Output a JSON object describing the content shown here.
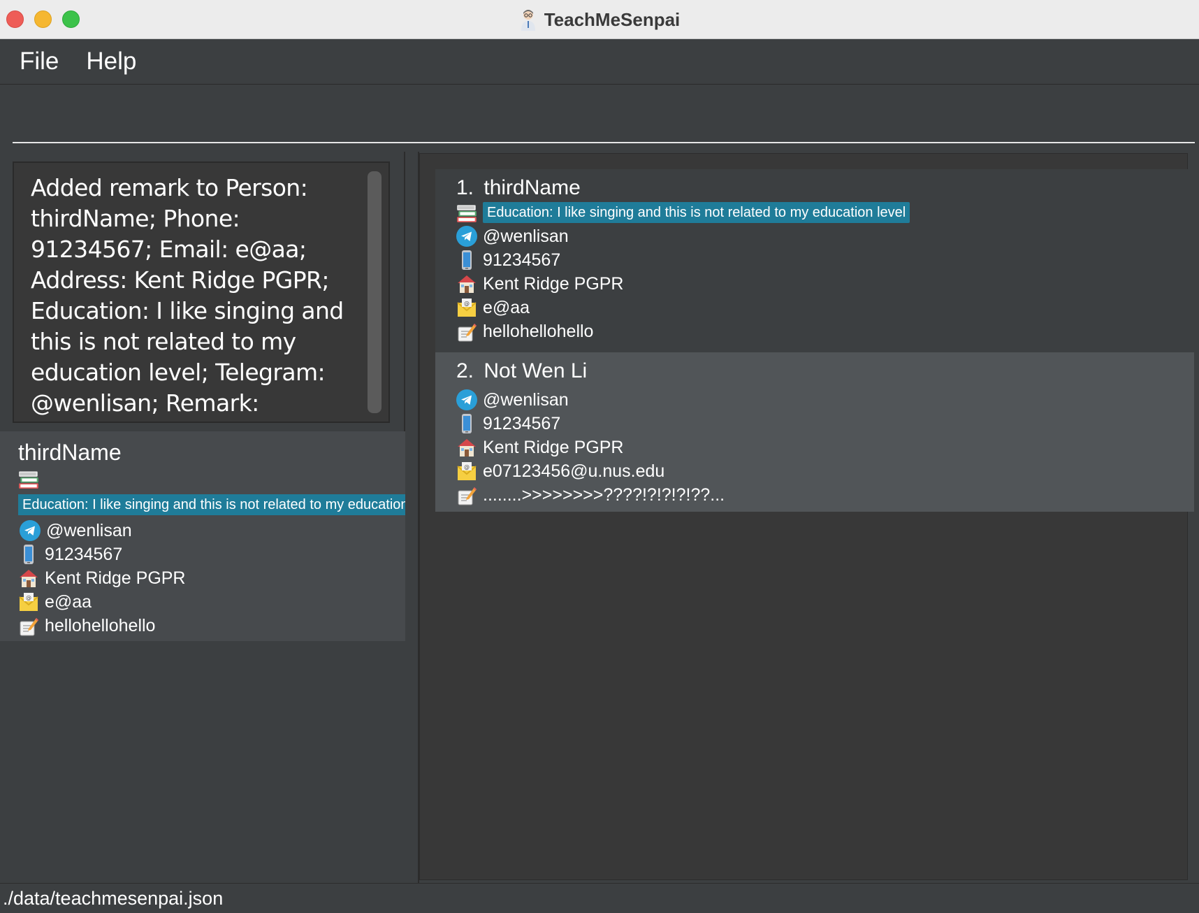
{
  "window": {
    "title": "TeachMeSenpai"
  },
  "menu": {
    "file": "File",
    "help": "Help"
  },
  "command": {
    "value": "",
    "placeholder": ""
  },
  "result": {
    "text": "Added remark to Person: thirdName; Phone: 91234567; Email: e@aa; Address: Kent Ridge PGPR; Education: I like singing and this is not related to my education level; Telegram: @wenlisan; Remark: hellohellohello"
  },
  "detail": {
    "name": "thirdName",
    "education": "Education: I like singing and this is not related to my education level",
    "telegram": "@wenlisan",
    "phone": "91234567",
    "address": "Kent Ridge PGPR",
    "email": "e@aa",
    "remark": "hellohellohello"
  },
  "persons": [
    {
      "index": "1.",
      "name": "thirdName",
      "education": "Education: I like singing and this is not related to my education level",
      "telegram": "@wenlisan",
      "phone": "91234567",
      "address": "Kent Ridge PGPR",
      "email": "e@aa",
      "remark": "hellohellohello"
    },
    {
      "index": "2.",
      "name": "Not Wen Li",
      "telegram": "@wenlisan",
      "phone": "91234567",
      "address": "Kent Ridge PGPR",
      "email": "e07123456@u.nus.edu",
      "remark": "........>>>>>>>>????!?!?!?!??..."
    }
  ],
  "status": {
    "path": "./data/teachmesenpai.json"
  },
  "colors": {
    "tag_background": "#1f7c99",
    "selected_card": "#515558",
    "telegram_blue": "#2a9fd8"
  },
  "icons": {
    "education": "books-icon",
    "telegram": "telegram-icon",
    "phone": "phone-icon",
    "address": "house-icon",
    "email": "envelope-icon",
    "remark": "memo-icon"
  }
}
